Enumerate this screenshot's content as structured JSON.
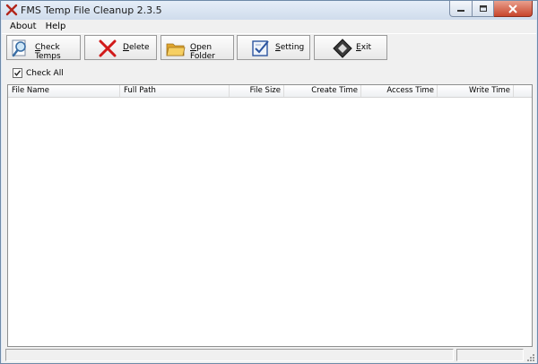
{
  "window": {
    "title": "FMS Temp File Cleanup 2.3.5"
  },
  "menu": [
    {
      "label": "About"
    },
    {
      "label": "Help"
    }
  ],
  "toolbar": {
    "check_temps": {
      "pre": "",
      "u": "C",
      "post": "heck Temps",
      "icon": "magnifier-icon"
    },
    "delete": {
      "pre": "",
      "u": "D",
      "post": "elete",
      "icon": "red-x-icon"
    },
    "open_folder": {
      "pre": "",
      "u": "O",
      "post": "pen Folder",
      "icon": "folder-icon"
    },
    "setting": {
      "pre": "",
      "u": "S",
      "post": "etting",
      "icon": "settings-icon"
    },
    "exit": {
      "pre": "",
      "u": "E",
      "post": "xit",
      "icon": "exit-icon"
    }
  },
  "check_all": {
    "label": "Check All",
    "checked": true
  },
  "columns": [
    "File Name",
    "Full Path",
    "File Size",
    "Create Time",
    "Access Time",
    "Write Time"
  ],
  "rows": [],
  "colors": {
    "titlebar": "#d7e3f1",
    "close_button": "#c8452c",
    "delete_icon": "#d11a1a",
    "folder_icon": "#f2c14e"
  }
}
